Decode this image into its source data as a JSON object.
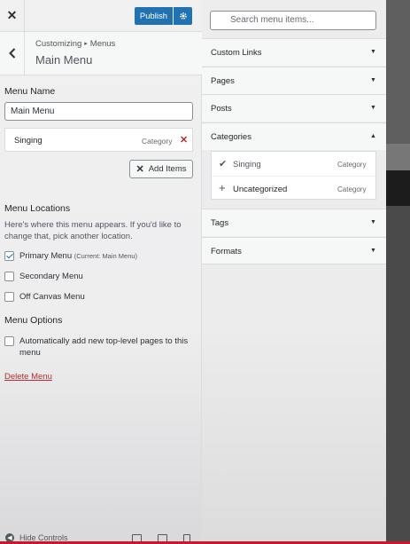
{
  "topbar": {
    "publish_label": "Publish"
  },
  "header": {
    "breadcrumb_root": "Customizing",
    "breadcrumb_sep": "▸",
    "breadcrumb_section": "Menus",
    "title": "Main Menu"
  },
  "menu_name": {
    "label": "Menu Name",
    "value": "Main Menu"
  },
  "menu_items": [
    {
      "name": "Singing",
      "type": "Category"
    }
  ],
  "add_items_label": "Add Items",
  "locations": {
    "heading": "Menu Locations",
    "description": "Here's where this menu appears. If you'd like to change that, pick another location.",
    "options": [
      {
        "label": "Primary Menu",
        "note": "(Current: Main Menu)",
        "checked": true
      },
      {
        "label": "Secondary Menu",
        "note": "",
        "checked": false
      },
      {
        "label": "Off Canvas Menu",
        "note": "",
        "checked": false
      }
    ]
  },
  "options": {
    "heading": "Menu Options",
    "auto_add_label": "Automatically add new top-level pages to this menu",
    "auto_add_checked": false
  },
  "delete_label": "Delete Menu",
  "hide_controls_label": "Hide Controls",
  "search": {
    "placeholder": "Search menu items..."
  },
  "sections": [
    {
      "label": "Custom Links",
      "expanded": false
    },
    {
      "label": "Pages",
      "expanded": false
    },
    {
      "label": "Posts",
      "expanded": false
    },
    {
      "label": "Categories",
      "expanded": true
    },
    {
      "label": "Tags",
      "expanded": false
    },
    {
      "label": "Formats",
      "expanded": false
    }
  ],
  "categories": [
    {
      "name": "Singing",
      "type": "Category",
      "added": true
    },
    {
      "name": "Uncategorized",
      "type": "Category",
      "added": false
    }
  ],
  "colors": {
    "primary": "#2271b1",
    "danger": "#b32d2e"
  }
}
